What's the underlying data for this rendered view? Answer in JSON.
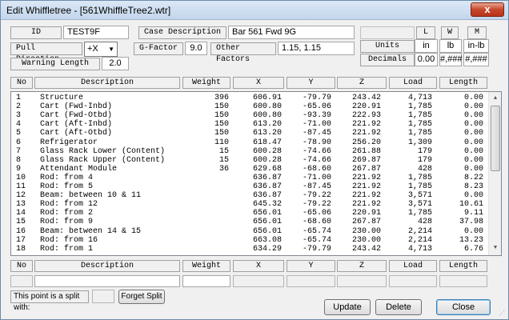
{
  "window": {
    "title": "Edit Whiffletree - [561WhiffleTree2.wtr]",
    "close_glyph": "x"
  },
  "form": {
    "id_label": "ID",
    "id_value": "TEST9F",
    "case_label": "Case Description",
    "case_value": "Bar 561 Fwd 9G",
    "pull_label": "Pull Direction",
    "pull_value": "+X",
    "gfactor_label": "G-Factor",
    "gfactor_value": "9.0",
    "other_label": "Other Factors",
    "other_value": "1.15, 1.15",
    "warning_label": "Warning Length",
    "warning_value": "2.0"
  },
  "units": {
    "col_headers": [
      "L",
      "W",
      "M"
    ],
    "units_label": "Units",
    "units_values": [
      "in",
      "lb",
      "in-lb"
    ],
    "decimals_label": "Decimals",
    "decimals_values": [
      "0.00",
      "#,###",
      "#,###"
    ]
  },
  "table": {
    "headers": [
      "No",
      "Description",
      "Weight",
      "X",
      "Y",
      "Z",
      "Load",
      "Length"
    ],
    "rows": [
      [
        "1",
        "Structure",
        "396",
        "606.91",
        "-79.79",
        "243.42",
        "4,713",
        "0.00"
      ],
      [
        "2",
        "Cart (Fwd-Inbd)",
        "150",
        "600.80",
        "-65.06",
        "220.91",
        "1,785",
        "0.00"
      ],
      [
        "3",
        "Cart (Fwd-Otbd)",
        "150",
        "600.80",
        "-93.39",
        "222.93",
        "1,785",
        "0.00"
      ],
      [
        "4",
        "Cart (Aft-Inbd)",
        "150",
        "613.20",
        "-71.00",
        "221.92",
        "1,785",
        "0.00"
      ],
      [
        "5",
        "Cart (Aft-Otbd)",
        "150",
        "613.20",
        "-87.45",
        "221.92",
        "1,785",
        "0.00"
      ],
      [
        "6",
        "Refrigerator",
        "110",
        "618.47",
        "-78.90",
        "256.20",
        "1,309",
        "0.00"
      ],
      [
        "7",
        "Glass Rack Lower (Content)",
        "15",
        "600.28",
        "-74.66",
        "261.88",
        "179",
        "0.00"
      ],
      [
        "8",
        "Glass Rack Upper (Content)",
        "15",
        "600.28",
        "-74.66",
        "269.87",
        "179",
        "0.00"
      ],
      [
        "9",
        "Attendant Module",
        "36",
        "629.68",
        "-68.60",
        "267.87",
        "428",
        "0.00"
      ],
      [
        "10",
        "Rod: from 4",
        "",
        "636.87",
        "-71.00",
        "221.92",
        "1,785",
        "8.22"
      ],
      [
        "11",
        "Rod: from 5",
        "",
        "636.87",
        "-87.45",
        "221.92",
        "1,785",
        "8.23"
      ],
      [
        "12",
        "Beam: between 10 & 11",
        "",
        "636.87",
        "-79.22",
        "221.92",
        "3,571",
        "0.00"
      ],
      [
        "13",
        "Rod: from 12",
        "",
        "645.32",
        "-79.22",
        "221.92",
        "3,571",
        "10.61"
      ],
      [
        "14",
        "Rod: from 2",
        "",
        "656.01",
        "-65.06",
        "220.91",
        "1,785",
        "9.11"
      ],
      [
        "15",
        "Rod: from 9",
        "",
        "656.01",
        "-68.60",
        "267.87",
        "428",
        "37.98"
      ],
      [
        "16",
        "Beam: between 14 & 15",
        "",
        "656.01",
        "-65.74",
        "230.00",
        "2,214",
        "0.00"
      ],
      [
        "17",
        "Rod: from 16",
        "",
        "663.08",
        "-65.74",
        "230.00",
        "2,214",
        "13.23"
      ],
      [
        "18",
        "Rod: from 1",
        "",
        "634.29",
        "-79.79",
        "243.42",
        "4,713",
        "6.76"
      ]
    ]
  },
  "edit_headers": [
    "No",
    "Description",
    "Weight",
    "X",
    "Y",
    "Z",
    "Load",
    "Length"
  ],
  "split": {
    "label": "This point is a split with:",
    "forget_label": "Forget Split"
  },
  "buttons": {
    "update": "Update",
    "delete": "Delete",
    "close": "Close"
  }
}
